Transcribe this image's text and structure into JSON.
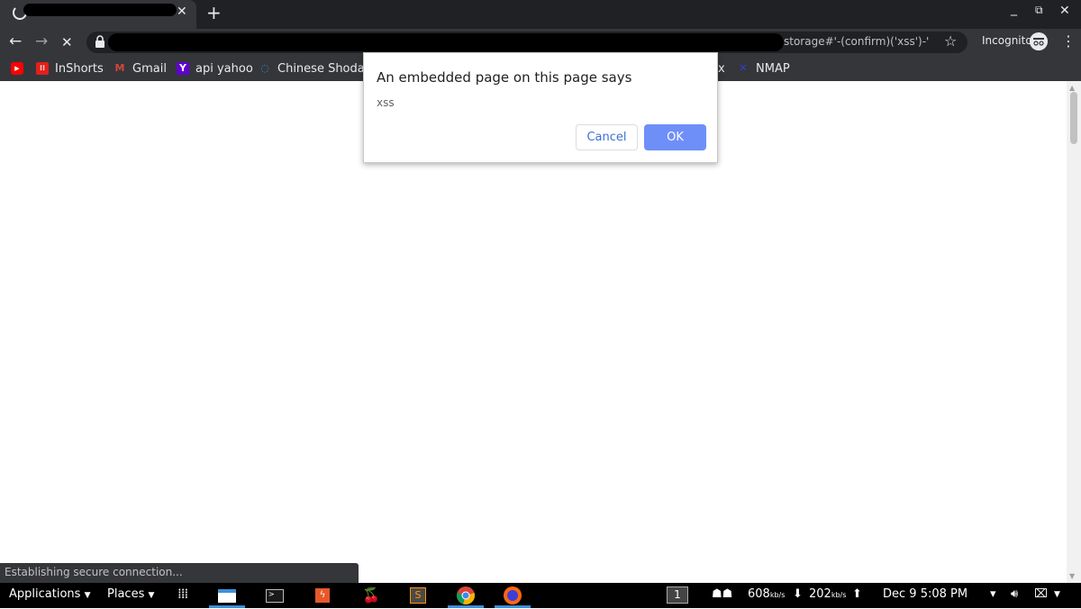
{
  "tab": {
    "title": ""
  },
  "toolbar": {
    "url_visible": "storage#'-(confirm)('xss')-'",
    "incognito_label": "Incognito"
  },
  "bookmarks": [
    {
      "label": "",
      "icon": "youtube-icon",
      "color": "#ff0000"
    },
    {
      "label": "InShorts",
      "icon": "inshorts-icon",
      "color": "#e2201c"
    },
    {
      "label": "Gmail",
      "icon": "gmail-icon",
      "color": "#d44638"
    },
    {
      "label": "api yahoo",
      "icon": "yahoo-icon",
      "color": "#5f01d1"
    },
    {
      "label": "Chinese Shodan",
      "icon": "chinese-shodan-icon",
      "color": "#3d8fd8"
    },
    {
      "label": "x",
      "icon": "",
      "color": "#e8eaed"
    },
    {
      "label": "NMAP",
      "icon": "nmap-icon",
      "color": "#3a3ad8"
    }
  ],
  "dialog": {
    "title": "An embedded page on this page says",
    "message": "xss",
    "cancel_label": "Cancel",
    "ok_label": "OK"
  },
  "status": {
    "text": "Establishing secure connection..."
  },
  "taskbar": {
    "applications_label": "Applications",
    "places_label": "Places",
    "workspace": "1",
    "net_down": "608",
    "net_down_unit": "kb/s",
    "net_up": "202",
    "net_up_unit": "kb/s",
    "clock": "Dec 9  5:08 PM"
  }
}
